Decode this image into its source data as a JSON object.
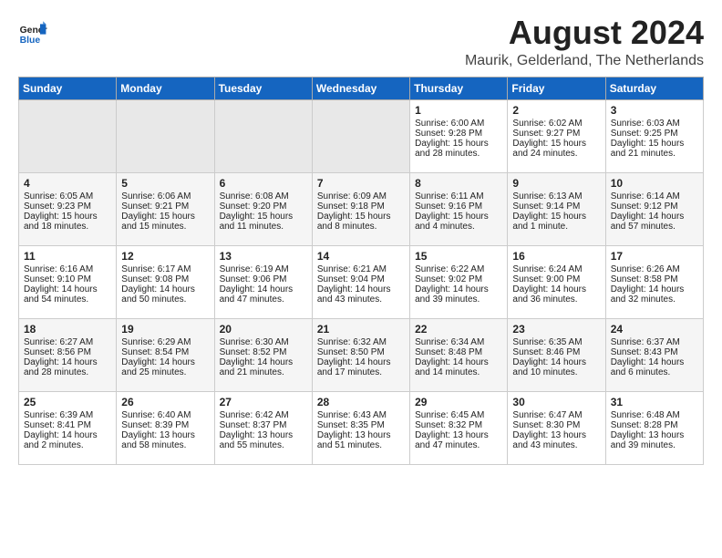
{
  "header": {
    "logo_line1": "General",
    "logo_line2": "Blue",
    "month_year": "August 2024",
    "location": "Maurik, Gelderland, The Netherlands"
  },
  "days_of_week": [
    "Sunday",
    "Monday",
    "Tuesday",
    "Wednesday",
    "Thursday",
    "Friday",
    "Saturday"
  ],
  "weeks": [
    [
      {
        "day": "",
        "info": ""
      },
      {
        "day": "",
        "info": ""
      },
      {
        "day": "",
        "info": ""
      },
      {
        "day": "",
        "info": ""
      },
      {
        "day": "1",
        "info": "Sunrise: 6:00 AM\nSunset: 9:28 PM\nDaylight: 15 hours\nand 28 minutes."
      },
      {
        "day": "2",
        "info": "Sunrise: 6:02 AM\nSunset: 9:27 PM\nDaylight: 15 hours\nand 24 minutes."
      },
      {
        "day": "3",
        "info": "Sunrise: 6:03 AM\nSunset: 9:25 PM\nDaylight: 15 hours\nand 21 minutes."
      }
    ],
    [
      {
        "day": "4",
        "info": "Sunrise: 6:05 AM\nSunset: 9:23 PM\nDaylight: 15 hours\nand 18 minutes."
      },
      {
        "day": "5",
        "info": "Sunrise: 6:06 AM\nSunset: 9:21 PM\nDaylight: 15 hours\nand 15 minutes."
      },
      {
        "day": "6",
        "info": "Sunrise: 6:08 AM\nSunset: 9:20 PM\nDaylight: 15 hours\nand 11 minutes."
      },
      {
        "day": "7",
        "info": "Sunrise: 6:09 AM\nSunset: 9:18 PM\nDaylight: 15 hours\nand 8 minutes."
      },
      {
        "day": "8",
        "info": "Sunrise: 6:11 AM\nSunset: 9:16 PM\nDaylight: 15 hours\nand 4 minutes."
      },
      {
        "day": "9",
        "info": "Sunrise: 6:13 AM\nSunset: 9:14 PM\nDaylight: 15 hours\nand 1 minute."
      },
      {
        "day": "10",
        "info": "Sunrise: 6:14 AM\nSunset: 9:12 PM\nDaylight: 14 hours\nand 57 minutes."
      }
    ],
    [
      {
        "day": "11",
        "info": "Sunrise: 6:16 AM\nSunset: 9:10 PM\nDaylight: 14 hours\nand 54 minutes."
      },
      {
        "day": "12",
        "info": "Sunrise: 6:17 AM\nSunset: 9:08 PM\nDaylight: 14 hours\nand 50 minutes."
      },
      {
        "day": "13",
        "info": "Sunrise: 6:19 AM\nSunset: 9:06 PM\nDaylight: 14 hours\nand 47 minutes."
      },
      {
        "day": "14",
        "info": "Sunrise: 6:21 AM\nSunset: 9:04 PM\nDaylight: 14 hours\nand 43 minutes."
      },
      {
        "day": "15",
        "info": "Sunrise: 6:22 AM\nSunset: 9:02 PM\nDaylight: 14 hours\nand 39 minutes."
      },
      {
        "day": "16",
        "info": "Sunrise: 6:24 AM\nSunset: 9:00 PM\nDaylight: 14 hours\nand 36 minutes."
      },
      {
        "day": "17",
        "info": "Sunrise: 6:26 AM\nSunset: 8:58 PM\nDaylight: 14 hours\nand 32 minutes."
      }
    ],
    [
      {
        "day": "18",
        "info": "Sunrise: 6:27 AM\nSunset: 8:56 PM\nDaylight: 14 hours\nand 28 minutes."
      },
      {
        "day": "19",
        "info": "Sunrise: 6:29 AM\nSunset: 8:54 PM\nDaylight: 14 hours\nand 25 minutes."
      },
      {
        "day": "20",
        "info": "Sunrise: 6:30 AM\nSunset: 8:52 PM\nDaylight: 14 hours\nand 21 minutes."
      },
      {
        "day": "21",
        "info": "Sunrise: 6:32 AM\nSunset: 8:50 PM\nDaylight: 14 hours\nand 17 minutes."
      },
      {
        "day": "22",
        "info": "Sunrise: 6:34 AM\nSunset: 8:48 PM\nDaylight: 14 hours\nand 14 minutes."
      },
      {
        "day": "23",
        "info": "Sunrise: 6:35 AM\nSunset: 8:46 PM\nDaylight: 14 hours\nand 10 minutes."
      },
      {
        "day": "24",
        "info": "Sunrise: 6:37 AM\nSunset: 8:43 PM\nDaylight: 14 hours\nand 6 minutes."
      }
    ],
    [
      {
        "day": "25",
        "info": "Sunrise: 6:39 AM\nSunset: 8:41 PM\nDaylight: 14 hours\nand 2 minutes."
      },
      {
        "day": "26",
        "info": "Sunrise: 6:40 AM\nSunset: 8:39 PM\nDaylight: 13 hours\nand 58 minutes."
      },
      {
        "day": "27",
        "info": "Sunrise: 6:42 AM\nSunset: 8:37 PM\nDaylight: 13 hours\nand 55 minutes."
      },
      {
        "day": "28",
        "info": "Sunrise: 6:43 AM\nSunset: 8:35 PM\nDaylight: 13 hours\nand 51 minutes."
      },
      {
        "day": "29",
        "info": "Sunrise: 6:45 AM\nSunset: 8:32 PM\nDaylight: 13 hours\nand 47 minutes."
      },
      {
        "day": "30",
        "info": "Sunrise: 6:47 AM\nSunset: 8:30 PM\nDaylight: 13 hours\nand 43 minutes."
      },
      {
        "day": "31",
        "info": "Sunrise: 6:48 AM\nSunset: 8:28 PM\nDaylight: 13 hours\nand 39 minutes."
      }
    ]
  ]
}
